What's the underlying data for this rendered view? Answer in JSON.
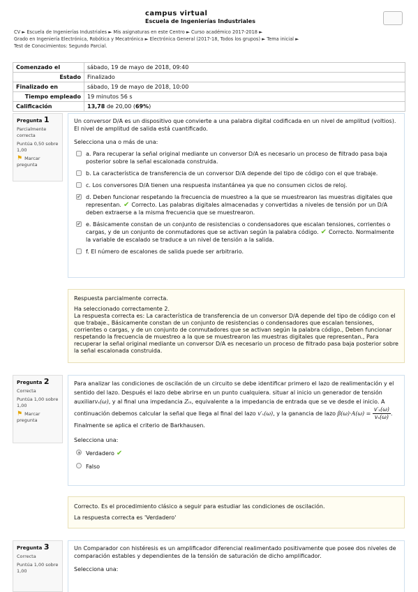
{
  "header": {
    "site_name": "campus virtual",
    "school": "Escuela de Ingenierías Industriales"
  },
  "breadcrumb": {
    "line1": "CV ► Escuela de Ingenierías Industriales ► Mis asignaturas en este Centro ► Curso académico 2017-2018 ►",
    "line2": "Grado en Ingeniería Electrónica, Robótica y Mecatrónica ► Electrónica General (2017-18, Todos los grupos) ► Tema inicial ►",
    "line3": "Test de Conocimientos: Segundo Parcial."
  },
  "summary": [
    {
      "label": "Comenzado el",
      "value": "sábado, 19 de mayo de 2018, 09:40"
    },
    {
      "label": "Estado",
      "value": "Finalizado"
    },
    {
      "label": "Finalizado en",
      "value": "sábado, 19 de mayo de 2018, 10:00"
    },
    {
      "label": "Tiempo empleado",
      "value": "19 minutos 56 s"
    },
    {
      "label": "Calificación",
      "value_bold": "13,78",
      "value_rest": " de 20,00 (",
      "pct": "69%",
      "close": ")"
    }
  ],
  "q1": {
    "label": "Pregunta",
    "num": "1",
    "state": "Parcialmente correcta",
    "mark": "Puntúa 0,50 sobre 1,00",
    "flag": "Marcar pregunta",
    "text": "Un conversor D/A es un dispositivo que convierte a una palabra digital codificada en un nivel de amplitud (voltios). El nivel de amplitud de salida está cuantificado.",
    "prompt": "Selecciona una o más de una:",
    "options": [
      {
        "text": "a. Para recuperar la señal original mediante un conversor D/A es necesario un proceso de filtrado pasa baja  posterior sobre la señal escalonada construida.",
        "feedback": ""
      },
      {
        "text": "b. La característica de transferencia de un conversor D/A depende del tipo de código con el que trabaje.",
        "feedback": ""
      },
      {
        "text": "c. Los conversores D/A tienen una respuesta instantánea ya que no consumen ciclos de reloj.",
        "feedback": ""
      },
      {
        "text": "d.  Deben funcionar respetando la frecuencia de muestreo a la que se muestrearon las muestras digitales que representan.",
        "feedback": "Correcto. Las palabras digitales almacenadas y convertidas a niveles de tensión por un D/A deben extraerse a la misma frecuencia que se muestrearon."
      },
      {
        "text": "e. Básicamente constan de un conjunto de resistencias o condensadores que escalan tensiones, corrientes o cargas, y de un conjunto de conmutadores que se activan según la palabra código.",
        "feedback": "Correcto. Normalmente la variable de escalado se traduce a un nivel de tensión a la salida."
      },
      {
        "text": "f.  El número de escalones de salida puede ser arbitrario.",
        "feedback": ""
      }
    ],
    "fb_line1": "Respuesta parcialmente correcta.",
    "fb_line2": "Ha seleccionado correctamente 2.",
    "fb_line3": "La respuesta correcta es: La característica de transferencia de un conversor D/A depende del tipo de código con el que trabaje., Básicamente constan de un conjunto de resistencias o condensadores que escalan tensiones, corrientes o cargas, y de un conjunto de conmutadores que se activan según la palabra código.,  Deben funcionar respetando la frecuencia de muestreo a la que se muestrearon las muestras digitales que representan., Para recuperar la señal original mediante un conversor D/A es necesario un proceso de filtrado pasa baja  posterior sobre la señal escalonada construida."
  },
  "q2": {
    "label": "Pregunta",
    "num": "2",
    "state": "Correcta",
    "mark": "Puntúa 1,00 sobre 1,00",
    "flag": "Marcar pregunta",
    "text1": "Para analizar las condiciones de oscilación de un circuito se debe identificar primero el lazo de realimentación y el sentido del lazo. Después el lazo debe abrirse en un punto cualquiera. situar al inicio un generador de tensión auxiliar",
    "math_vx": "vₓ(ω)",
    "text2": ", y al final una impedancia",
    "math_z": "Zᵢₙ",
    "text3": ", equivalente a la impedancia de entrada que se ve desde el inicio. A continuación debemos calcular la señal que llega  al final del lazo",
    "math_vxp": "v′ₓ(ω)",
    "text4": ", y la ganancia de lazo",
    "math_beta": "β(ω)·A(ω) =",
    "frac_num": "v′ₓ(ω)",
    "frac_den": "vₓ(ω)",
    "text5": ". Finalmente se aplica el criterio de Barkhausen.",
    "prompt": "Selecciona una:",
    "opt_true": "Verdadero",
    "opt_false": "Falso",
    "fb_line1": "Correcto. Es el procedimiento clásico a seguir para estudiar las condiciones de oscilación.",
    "fb_line2": "La respuesta correcta es 'Verdadero'"
  },
  "q3": {
    "label": "Pregunta",
    "num": "3",
    "state": "Correcta",
    "mark": "Puntúa 1,00 sobre 1,00",
    "text": "Un Comparador con histéresis es un amplificador diferencial realimentado positivamente que posee dos niveles de comparación estables y dependientes de la tensión de saturación de dicho amplificador.",
    "prompt": "Selecciona una:"
  }
}
